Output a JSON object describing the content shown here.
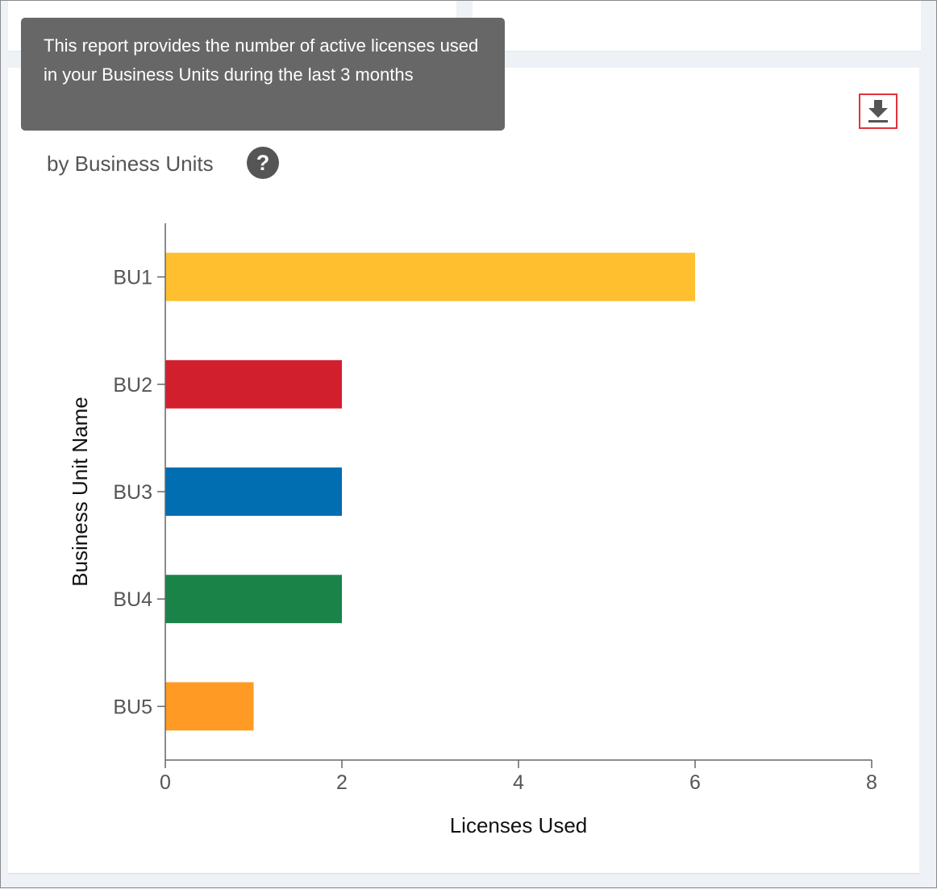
{
  "tooltip": {
    "text": "This report provides the number of active licenses used in your Business Units during the last 3 months"
  },
  "card": {
    "subtitle": "by Business Units",
    "help_symbol": "?"
  },
  "icons": {
    "help": "question-circle-icon",
    "download": "download-icon"
  },
  "chart_data": {
    "type": "bar",
    "orientation": "horizontal",
    "categories": [
      "BU1",
      "BU2",
      "BU3",
      "BU4",
      "BU5"
    ],
    "values": [
      6,
      2,
      2,
      2,
      1
    ],
    "colors": [
      "#ffbf2f",
      "#d21f2e",
      "#006eb0",
      "#1a8348",
      "#ff9a24"
    ],
    "xlabel": "Licenses Used",
    "ylabel": "Business Unit Name",
    "xlim": [
      0,
      8
    ],
    "xticks": [
      0,
      2,
      4,
      6,
      8
    ],
    "grid": false,
    "legend": "none"
  }
}
